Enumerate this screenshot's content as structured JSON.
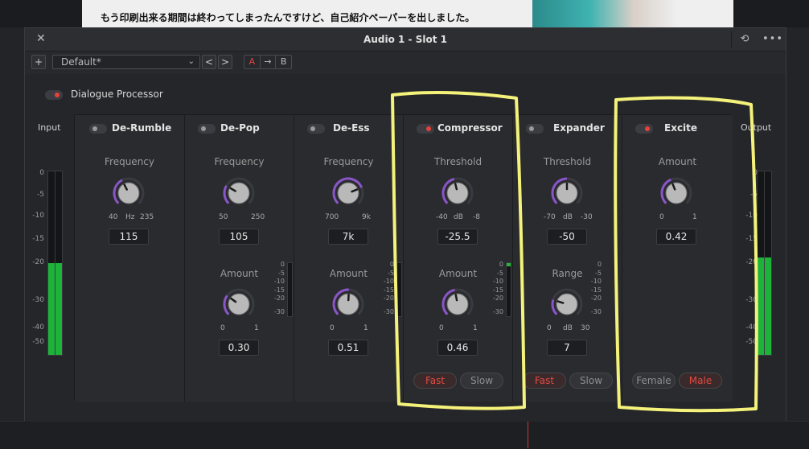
{
  "background": {
    "subtitle": "もう印刷出来る期間は終わってしまったんですけど、自己紹介ペーパーを出しました。"
  },
  "window": {
    "title": "Audio 1 - Slot 1",
    "close_icon": "close-icon",
    "history_icon": "history-icon",
    "more_icon": "more-icon"
  },
  "toolbar": {
    "add_label": "+",
    "preset_value": "Default*",
    "prev_label": "<",
    "next_label": ">",
    "a_label": "A",
    "copy_label": "→",
    "b_label": "B"
  },
  "dialogue_processor": {
    "label": "Dialogue Processor",
    "enabled": true
  },
  "input": {
    "label": "Input",
    "level_fraction": 0.5,
    "scale": [
      "0",
      "-5",
      "-10",
      "-15",
      "-20",
      "-30",
      "-40",
      "-50"
    ]
  },
  "output": {
    "label": "Output",
    "level_fraction": 0.53,
    "scale": [
      "0",
      "-5",
      "-10",
      "-15",
      "-20",
      "-30",
      "-40",
      "-50"
    ]
  },
  "mini_scale": [
    "0",
    "-5",
    "-10",
    "-15",
    "-20",
    "-30"
  ],
  "modules": [
    {
      "name": "De-Rumble",
      "enabled": false,
      "param1": {
        "label": "Frequency",
        "min": "40",
        "unit": "Hz",
        "max": "235",
        "value": "115",
        "level": 0.4
      }
    },
    {
      "name": "De-Pop",
      "enabled": false,
      "param1": {
        "label": "Frequency",
        "min": "50",
        "unit": "",
        "max": "250",
        "value": "105",
        "level": 0.28
      },
      "param2": {
        "label": "Amount",
        "min": "0",
        "max": "1",
        "value": "0.30",
        "level": 0.3
      }
    },
    {
      "name": "De-Ess",
      "enabled": false,
      "param1": {
        "label": "Frequency",
        "min": "700",
        "unit": "",
        "max": "9k",
        "value": "7k",
        "level": 0.75
      },
      "param2": {
        "label": "Amount",
        "min": "0",
        "max": "1",
        "value": "0.51",
        "level": 0.51
      }
    },
    {
      "name": "Compressor",
      "enabled": true,
      "param1": {
        "label": "Threshold",
        "min": "-40",
        "unit": "dB",
        "max": "-8",
        "value": "-25.5",
        "level": 0.45
      },
      "param2": {
        "label": "Amount",
        "min": "0",
        "max": "1",
        "value": "0.46",
        "level": 0.46
      },
      "modes": [
        "Fast",
        "Slow"
      ],
      "active_mode": "Fast"
    },
    {
      "name": "Expander",
      "enabled": false,
      "param1": {
        "label": "Threshold",
        "min": "-70",
        "unit": "dB",
        "max": "-30",
        "value": "-50",
        "level": 0.5
      },
      "param2": {
        "label": "Range",
        "min": "0",
        "unit": "dB",
        "max": "30",
        "value": "7",
        "level": 0.23
      },
      "modes": [
        "Fast",
        "Slow"
      ],
      "active_mode": "Fast"
    },
    {
      "name": "Excite",
      "enabled": true,
      "param1": {
        "label": "Amount",
        "min": "0",
        "unit": "",
        "max": "1",
        "value": "0.42",
        "level": 0.42
      },
      "modes": [
        "Female",
        "Male"
      ],
      "active_mode": "Male"
    }
  ],
  "colors": {
    "accent_red": "#e8403a",
    "knob_purple": "#8a55c9",
    "meter_green": "#1db33a",
    "annotation_yellow": "#f4f27a"
  }
}
